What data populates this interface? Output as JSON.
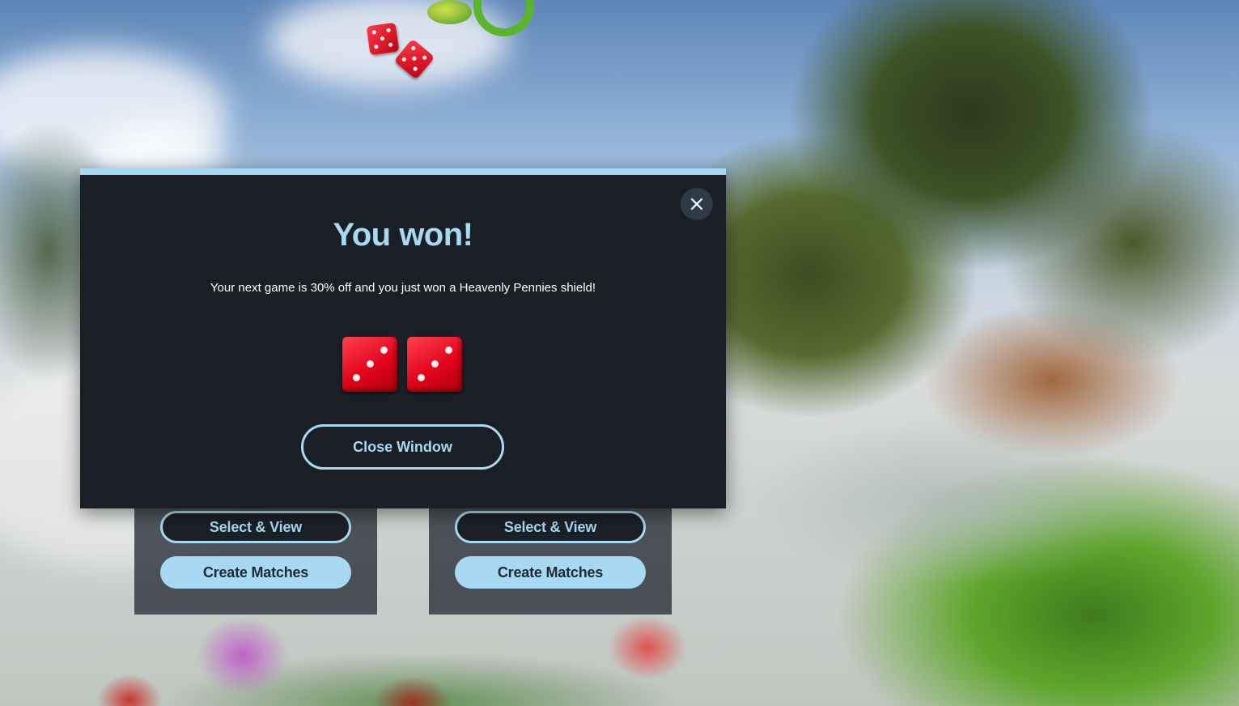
{
  "modal": {
    "title": "You won!",
    "message": "Your next game is 30% off and you just won a Heavenly Pennies shield!",
    "dice_values": [
      3,
      3
    ],
    "close_button_label": "Close Window",
    "close_icon": "close-icon"
  },
  "cards": [
    {
      "select_label": "Select & View",
      "create_label": "Create Matches"
    },
    {
      "select_label": "Select & View",
      "create_label": "Create Matches"
    }
  ],
  "colors": {
    "accent": "#a7d9f2",
    "modal_bg": "#1a1e25",
    "dice_red": "#e3041a"
  }
}
